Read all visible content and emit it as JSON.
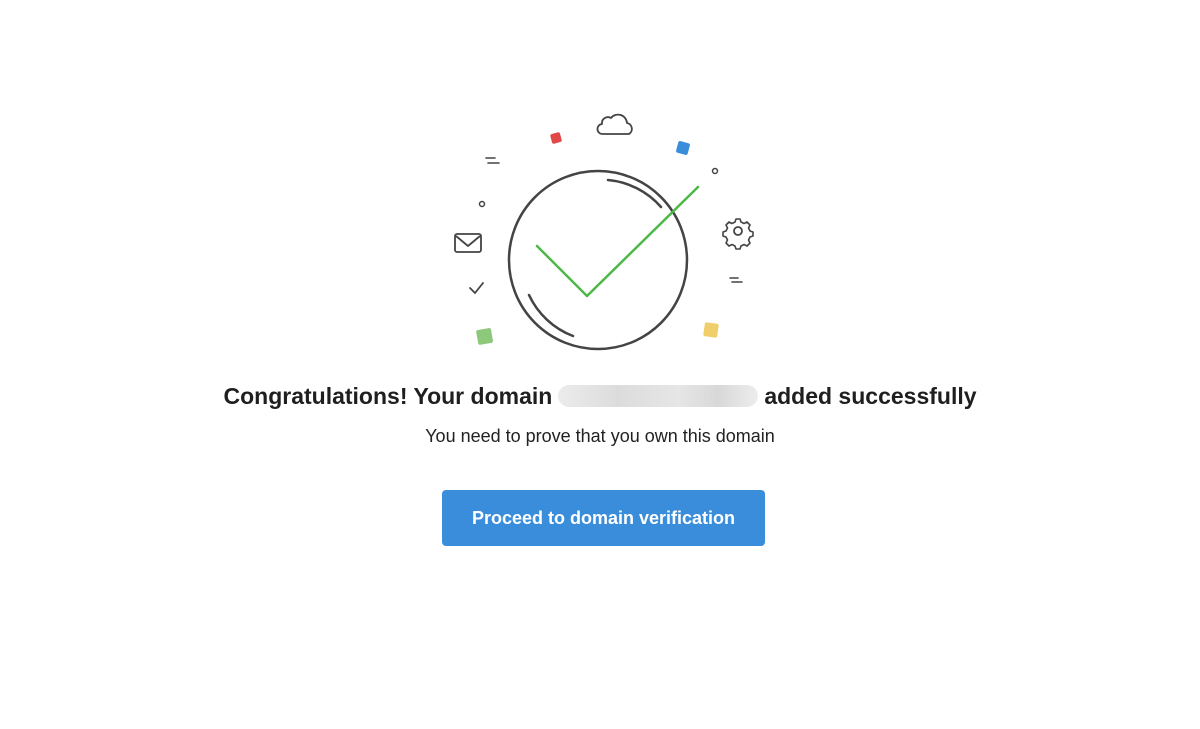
{
  "success_panel": {
    "headline_prefix": "Congratulations! Your domain",
    "headline_suffix": "added successfully",
    "subtitle": "You need to prove that you own this domain",
    "cta_label": "Proceed to domain verification"
  },
  "colors": {
    "accent": "#3a8ddb",
    "check": "#4cb848",
    "confetti_red": "#e04848",
    "confetti_blue": "#3a8ddb",
    "confetti_green": "#8cc97a",
    "confetti_yellow": "#f0cf6a"
  },
  "icons": [
    "success-check-icon",
    "cloud-icon",
    "mail-icon",
    "gear-icon",
    "small-check-icon"
  ]
}
